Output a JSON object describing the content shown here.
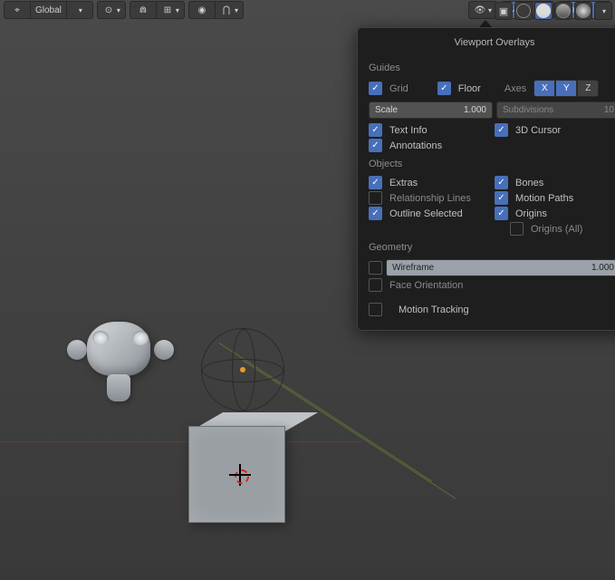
{
  "topbar": {
    "orientation_label": "Global"
  },
  "popover": {
    "title": "Viewport Overlays",
    "sections": {
      "guides": {
        "title": "Guides",
        "grid": {
          "label": "Grid",
          "checked": true
        },
        "floor": {
          "label": "Floor",
          "checked": true
        },
        "axes_label": "Axes",
        "axes": {
          "X": true,
          "Y": true,
          "Z": false
        },
        "scale": {
          "label": "Scale",
          "value": "1.000"
        },
        "subdivisions": {
          "label": "Subdivisions",
          "value": "10"
        },
        "text_info": {
          "label": "Text Info",
          "checked": true
        },
        "cursor3d": {
          "label": "3D Cursor",
          "checked": true
        },
        "annotations": {
          "label": "Annotations",
          "checked": true
        }
      },
      "objects": {
        "title": "Objects",
        "extras": {
          "label": "Extras",
          "checked": true
        },
        "relationship": {
          "label": "Relationship Lines",
          "checked": false
        },
        "outline_selected": {
          "label": "Outline Selected",
          "checked": true
        },
        "bones": {
          "label": "Bones",
          "checked": true
        },
        "motion_paths": {
          "label": "Motion Paths",
          "checked": true
        },
        "origins": {
          "label": "Origins",
          "checked": true
        },
        "origins_all": {
          "label": "Origins (All)",
          "checked": false
        }
      },
      "geometry": {
        "title": "Geometry",
        "wireframe": {
          "label": "Wireframe",
          "value": "1.000",
          "checked": false
        },
        "face_orientation": {
          "label": "Face Orientation",
          "checked": false
        }
      },
      "motion_tracking": {
        "label": "Motion Tracking",
        "checked": false
      }
    }
  }
}
